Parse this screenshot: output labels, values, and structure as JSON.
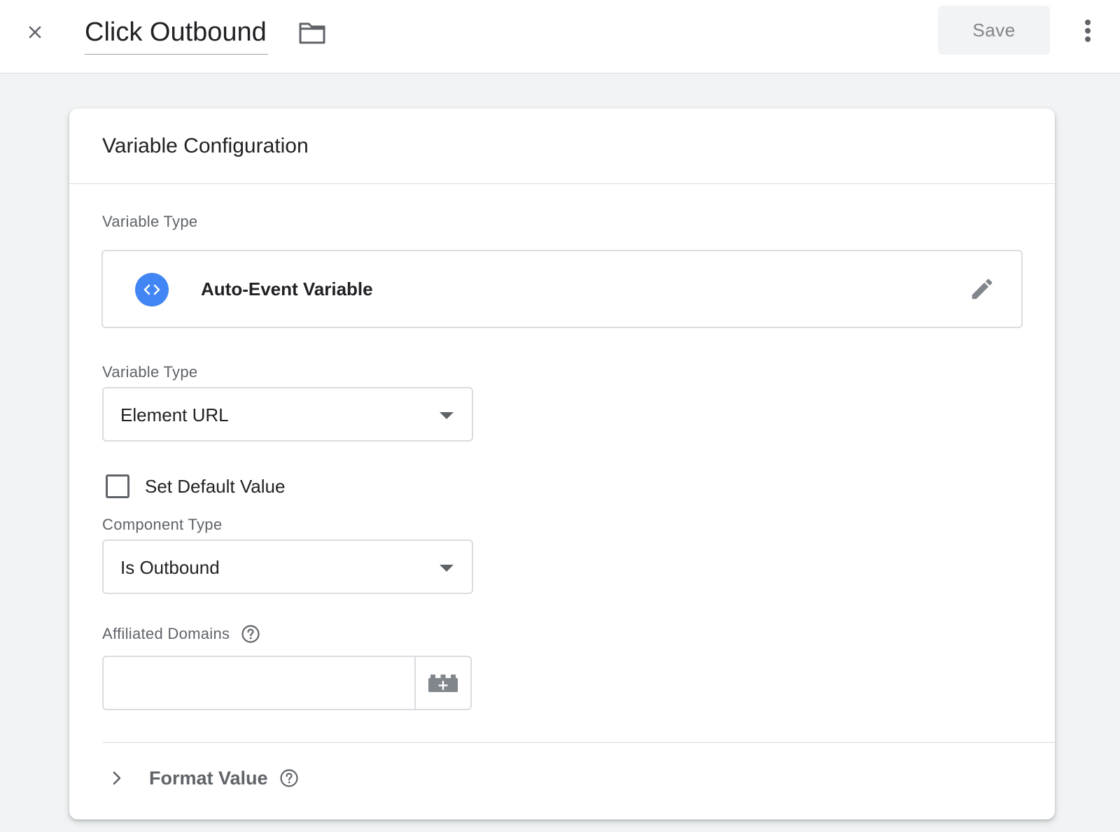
{
  "header": {
    "title": "Click Outbound",
    "save_label": "Save",
    "icons": {
      "close": "close-icon",
      "folder": "folder-icon",
      "more": "more-vert-icon"
    }
  },
  "card": {
    "title": "Variable Configuration",
    "variable_type_section": {
      "label": "Variable Type",
      "selected_type": "Auto-Event Variable",
      "type_icon": "code-brackets-icon",
      "edit_icon": "pencil-icon"
    },
    "variable_type_select": {
      "label": "Variable Type",
      "value": "Element URL"
    },
    "default_value": {
      "label": "Set Default Value",
      "checked": false
    },
    "component_type_select": {
      "label": "Component Type",
      "value": "Is Outbound"
    },
    "affiliated_domains": {
      "label": "Affiliated Domains",
      "value": "",
      "help_icon": "help-circle-icon",
      "variable_button_icon": "add-variable-icon"
    },
    "format_value": {
      "label": "Format Value",
      "expanded": false,
      "help_icon": "help-circle-icon"
    }
  },
  "colors": {
    "accent_blue": "#4285f4",
    "page_bg": "#f1f3f4",
    "text_primary": "#202124",
    "text_secondary": "#5f6368",
    "border": "#dadce0"
  }
}
